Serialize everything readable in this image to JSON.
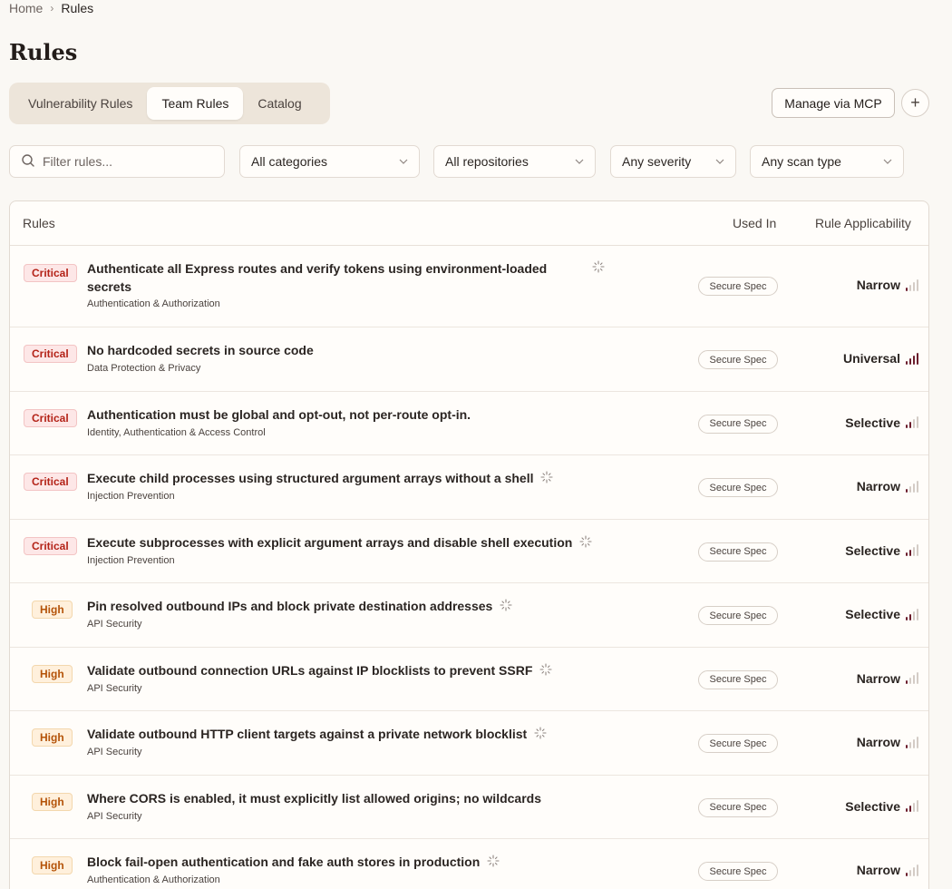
{
  "breadcrumb": {
    "home": "Home",
    "separator": "›",
    "current": "Rules"
  },
  "page_title": "Rules",
  "tabs": [
    {
      "label": "Vulnerability Rules",
      "active": false
    },
    {
      "label": "Team Rules",
      "active": true
    },
    {
      "label": "Catalog",
      "active": false
    }
  ],
  "actions": {
    "manage_mcp": "Manage via MCP",
    "add": "+"
  },
  "filters": {
    "search_placeholder": "Filter rules...",
    "category": "All categories",
    "repository": "All repositories",
    "severity": "Any severity",
    "scan_type": "Any scan type"
  },
  "table": {
    "headers": {
      "rules": "Rules",
      "used_in": "Used In",
      "applicability": "Rule Applicability"
    },
    "rows": [
      {
        "severity": "Critical",
        "title_line1": "Authenticate all Express routes and verify tokens using environment-loaded",
        "title_line2": "secrets",
        "category": "Authentication & Authorization",
        "used_in": "Secure Spec",
        "applicability": "Narrow",
        "level": 1,
        "ai": true
      },
      {
        "severity": "Critical",
        "title": "No hardcoded secrets in source code",
        "category": "Data Protection & Privacy",
        "used_in": "Secure Spec",
        "applicability": "Universal",
        "level": 4,
        "ai": false
      },
      {
        "severity": "Critical",
        "title": "Authentication must be global and opt-out, not per-route opt-in.",
        "category": "Identity, Authentication & Access Control",
        "used_in": "Secure Spec",
        "applicability": "Selective",
        "level": 2,
        "ai": false
      },
      {
        "severity": "Critical",
        "title": "Execute child processes using structured argument arrays without a shell",
        "category": "Injection Prevention",
        "used_in": "Secure Spec",
        "applicability": "Narrow",
        "level": 1,
        "ai": true
      },
      {
        "severity": "Critical",
        "title": "Execute subprocesses with explicit argument arrays and disable shell execution",
        "category": "Injection Prevention",
        "used_in": "Secure Spec",
        "applicability": "Selective",
        "level": 2,
        "ai": true
      },
      {
        "severity": "High",
        "title": "Pin resolved outbound IPs and block private destination addresses",
        "category": "API Security",
        "used_in": "Secure Spec",
        "applicability": "Selective",
        "level": 2,
        "ai": true
      },
      {
        "severity": "High",
        "title": "Validate outbound connection URLs against IP blocklists to prevent SSRF",
        "category": "API Security",
        "used_in": "Secure Spec",
        "applicability": "Narrow",
        "level": 1,
        "ai": true
      },
      {
        "severity": "High",
        "title": "Validate outbound HTTP client targets against a private network blocklist",
        "category": "API Security",
        "used_in": "Secure Spec",
        "applicability": "Narrow",
        "level": 1,
        "ai": true
      },
      {
        "severity": "High",
        "title": "Where CORS is enabled, it must explicitly list allowed origins; no wildcards",
        "category": "API Security",
        "used_in": "Secure Spec",
        "applicability": "Selective",
        "level": 2,
        "ai": false
      },
      {
        "severity": "High",
        "title": "Block fail-open authentication and fake auth stores in production",
        "category": "Authentication & Authorization",
        "used_in": "Secure Spec",
        "applicability": "Narrow",
        "level": 1,
        "ai": true
      }
    ]
  },
  "colors": {
    "accent": "#6b1d2c",
    "critical": "#b42318",
    "high": "#b45309",
    "background": "#faf8f4"
  },
  "icons": {
    "search": "search-icon",
    "chevron": "chevron-down-icon",
    "ai": "sparkle-icon",
    "applicability": "signal-bars-icon"
  }
}
